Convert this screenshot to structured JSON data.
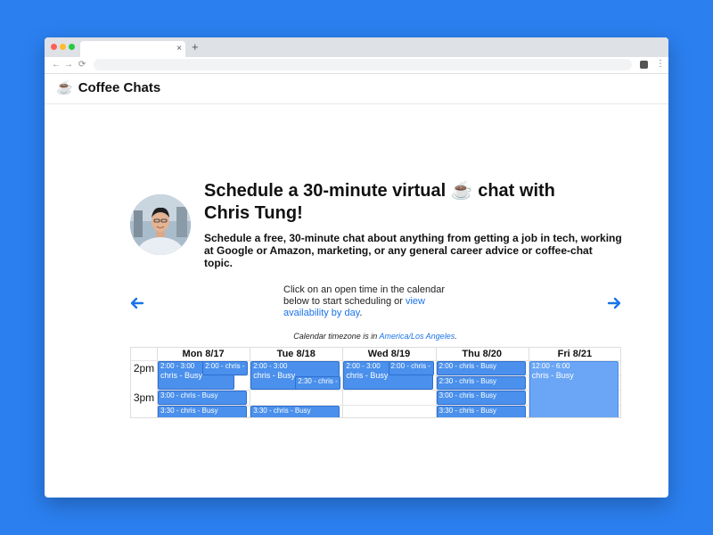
{
  "browser": {
    "tab_close": "×",
    "new_tab": "+",
    "back": "←",
    "forward": "→",
    "reload": "⟳",
    "menu": "⋮"
  },
  "site": {
    "logo_emoji": "☕",
    "title": "Coffee Chats"
  },
  "hero": {
    "title_part1": "Schedule a 30-minute virtual ",
    "title_emoji": "☕",
    "title_part2": " chat with Chris Tung!",
    "subtitle": "Schedule a free, 30-minute chat about anything from getting a job in tech, working at Google or Amazon, marketing, or any general career advice or coffee-chat topic."
  },
  "instructions": {
    "text": "Click on an open time in the calendar below to start scheduling or ",
    "link": "view availability by day",
    "end": "."
  },
  "timezone": {
    "prefix": "Calendar timezone is in ",
    "link": "America/Los Angeles",
    "suffix": "."
  },
  "calendar": {
    "days": [
      "Mon 8/17",
      "Tue 8/18",
      "Wed 8/19",
      "Thu 8/20",
      "Fri 8/21"
    ],
    "hours": [
      "2pm",
      "3pm"
    ],
    "events": [
      {
        "day": 0,
        "start": 14.0,
        "end": 15.0,
        "lane": 0,
        "lanes": 2,
        "time": "2:00 - 3:00",
        "name": "chris - Busy"
      },
      {
        "day": 0,
        "start": 14.0,
        "end": 14.5,
        "lane": 1,
        "lanes": 2,
        "time": "2:00 - chris -",
        "name": ""
      },
      {
        "day": 0,
        "start": 15.0,
        "end": 15.5,
        "lane": 0,
        "lanes": 1,
        "time": "3:00 - chris - Busy",
        "name": ""
      },
      {
        "day": 0,
        "start": 15.5,
        "end": 16.0,
        "lane": 0,
        "lanes": 1,
        "time": "3:30 - chris - Busy",
        "name": ""
      },
      {
        "day": 1,
        "start": 14.0,
        "end": 15.0,
        "lane": 0,
        "lanes": 1,
        "time": "2:00 - 3:00",
        "name": "chris - Busy"
      },
      {
        "day": 1,
        "start": 14.5,
        "end": 15.0,
        "lane": 1,
        "lanes": 2,
        "time": "2:30 - chris -",
        "name": ""
      },
      {
        "day": 1,
        "start": 15.5,
        "end": 16.0,
        "lane": 0,
        "lanes": 1,
        "time": "3:30 - chris - Busy",
        "name": ""
      },
      {
        "day": 2,
        "start": 14.0,
        "end": 15.0,
        "lane": 0,
        "lanes": 1,
        "time": "2:00 - 3:00",
        "name": "chris - Busy"
      },
      {
        "day": 2,
        "start": 14.0,
        "end": 14.5,
        "lane": 1,
        "lanes": 2,
        "time": "2:00 - chris -",
        "name": ""
      },
      {
        "day": 3,
        "start": 14.0,
        "end": 14.5,
        "lane": 0,
        "lanes": 1,
        "time": "2:00 - chris - Busy",
        "name": ""
      },
      {
        "day": 3,
        "start": 14.5,
        "end": 15.0,
        "lane": 0,
        "lanes": 1,
        "time": "2:30 - chris - Busy",
        "name": ""
      },
      {
        "day": 3,
        "start": 15.0,
        "end": 15.5,
        "lane": 0,
        "lanes": 1,
        "time": "3:00 - chris - Busy",
        "name": ""
      },
      {
        "day": 3,
        "start": 15.5,
        "end": 16.0,
        "lane": 0,
        "lanes": 1,
        "time": "3:30 - chris - Busy",
        "name": ""
      },
      {
        "day": 4,
        "start": 14.0,
        "end": 16.0,
        "lane": 0,
        "lanes": 1,
        "time": "12:00 - 6:00",
        "name": "chris - Busy",
        "light": true
      }
    ]
  },
  "colors": {
    "background": "#2b7fef",
    "accent": "#1a73e8",
    "event": "#4a90ec"
  }
}
